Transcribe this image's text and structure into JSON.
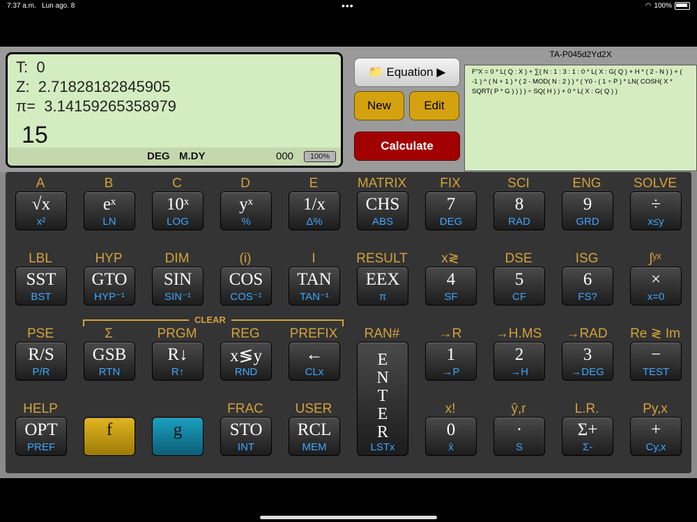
{
  "status": {
    "time": "7:37 a.m.",
    "date": "Lun ago. 8",
    "dots": "•••",
    "battery": "100%"
  },
  "display": {
    "t_label": "T:",
    "t_value": "0",
    "z_label": "Z:",
    "z_value": "2.71828182845905",
    "pi_label": "π=",
    "pi_value": "3.14159265358979",
    "x_value": "15",
    "angle_mode": "DEG",
    "date_mode": "M.DY",
    "counter": "000",
    "battery": "100%"
  },
  "buttons": {
    "equation": "📁 Equation ▶",
    "new": "New",
    "edit": "Edit",
    "calculate": "Calculate"
  },
  "program": {
    "id": "TA-P045d2Yd2X",
    "text": "F\"X = 0 * L( Q : X ) + ∑( N : 1 : 3 : 1 : 0 * L( X : G( Q ) + H * ( 2 - N ) ) + ( -1 ) ^ ( N + 1 ) * ( 2 - MOD( N : 2 ) ) * ( Y0 - ( 1 ÷ P ) * LN( COSH( X * SQRT( P * G ) ) ) ) ÷ SQ( H ) ) + 0 * L( X : G( Q ) )"
  },
  "clear_label": "CLEAR",
  "keys": [
    {
      "f": "A",
      "m": "√x",
      "g": "x²"
    },
    {
      "f": "B",
      "m": "eˣ",
      "g": "LN"
    },
    {
      "f": "C",
      "m": "10ˣ",
      "g": "LOG"
    },
    {
      "f": "D",
      "m": "yˣ",
      "g": "%"
    },
    {
      "f": "E",
      "m": "1/x",
      "g": "Δ%"
    },
    {
      "f": "MATRIX",
      "m": "CHS",
      "g": "ABS"
    },
    {
      "f": "FIX",
      "m": "7",
      "g": "DEG"
    },
    {
      "f": "SCI",
      "m": "8",
      "g": "RAD"
    },
    {
      "f": "ENG",
      "m": "9",
      "g": "GRD"
    },
    {
      "f": "SOLVE",
      "m": "÷",
      "g": "x≤y"
    },
    {
      "f": "LBL",
      "m": "SST",
      "g": "BST"
    },
    {
      "f": "HYP",
      "m": "GTO",
      "g": "HYP⁻¹"
    },
    {
      "f": "DIM",
      "m": "SIN",
      "g": "SIN⁻¹"
    },
    {
      "f": "(i)",
      "m": "COS",
      "g": "COS⁻¹"
    },
    {
      "f": "I",
      "m": "TAN",
      "g": "TAN⁻¹"
    },
    {
      "f": "RESULT",
      "m": "EEX",
      "g": "π"
    },
    {
      "f": "x≷",
      "m": "4",
      "g": "SF"
    },
    {
      "f": "DSE",
      "m": "5",
      "g": "CF"
    },
    {
      "f": "ISG",
      "m": "6",
      "g": "FS?"
    },
    {
      "f": "∫ʸˣ",
      "m": "×",
      "g": "x=0"
    },
    {
      "f": "PSE",
      "m": "R/S",
      "g": "P/R"
    },
    {
      "f": "Σ",
      "m": "GSB",
      "g": "RTN"
    },
    {
      "f": "PRGM",
      "m": "R↓",
      "g": "R↑"
    },
    {
      "f": "REG",
      "m": "x≶y",
      "g": "RND"
    },
    {
      "f": "PREFIX",
      "m": "←",
      "g": "CLx"
    },
    {
      "f": "RAN#",
      "m": "E N T E R",
      "g": "LSTx"
    },
    {
      "f": "→R",
      "m": "1",
      "g": "→P"
    },
    {
      "f": "→H.MS",
      "m": "2",
      "g": "→H"
    },
    {
      "f": "→RAD",
      "m": "3",
      "g": "→DEG"
    },
    {
      "f": "Re ≷ Im",
      "m": "−",
      "g": "TEST"
    },
    {
      "f": "HELP",
      "m": "OPT",
      "g": "PREF"
    },
    {
      "f": "",
      "m": "f",
      "g": ""
    },
    {
      "f": "",
      "m": "g",
      "g": ""
    },
    {
      "f": "FRAC",
      "m": "STO",
      "g": "INT"
    },
    {
      "f": "USER",
      "m": "RCL",
      "g": "MEM"
    },
    {
      "f": "x!",
      "m": "0",
      "g": "x̄"
    },
    {
      "f": "ŷ,r",
      "m": "·",
      "g": "S"
    },
    {
      "f": "L.R.",
      "m": "Σ+",
      "g": "Σ-"
    },
    {
      "f": "Py,x",
      "m": "+",
      "g": "Cy,x"
    }
  ]
}
